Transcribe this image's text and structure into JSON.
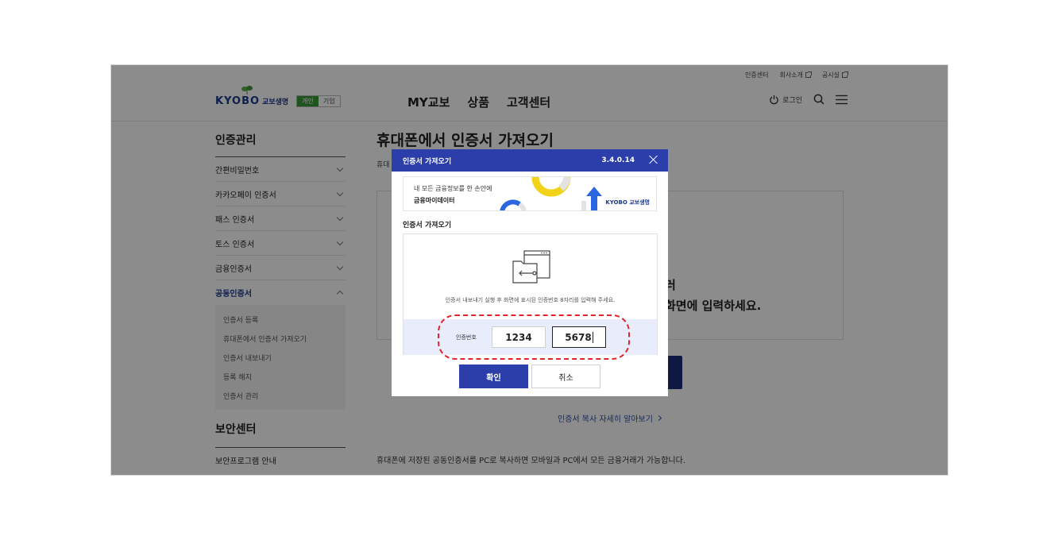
{
  "header": {
    "util": [
      "인증센터",
      "회사소개",
      "공시실"
    ],
    "logo_text": "KYOBO",
    "logo_kr": "교보생명",
    "toggle": [
      "개인",
      "기업"
    ],
    "gnb": [
      "MY교보",
      "상품",
      "고객센터"
    ],
    "login_label": "로그인"
  },
  "sidebar": {
    "title": "인증관리",
    "items": [
      {
        "label": "간편비밀번호"
      },
      {
        "label": "카카오페이 인증서"
      },
      {
        "label": "패스 인증서"
      },
      {
        "label": "토스 인증서"
      },
      {
        "label": "금융인증서"
      },
      {
        "label": "공동인증서"
      }
    ],
    "sub_items": [
      "인증서 등록",
      "휴대폰에서 인증서 가져오기",
      "인증서 내보내기",
      "등록 해지",
      "인증서 관리"
    ],
    "title2": "보안센터",
    "item2": "보안프로그램 안내"
  },
  "main": {
    "title": "휴대폰에서 인증서 가져오기",
    "desc_fragment": "휴대",
    "text_line1": "러",
    "text_line2": "화면에 입력하세요.",
    "more_link": "인증서 복사 자세히 알아보기",
    "footer": "휴대폰에 저장된 공동인증서를 PC로 복사하면 모바일과 PC에서 모든 금융거래가 가능합니다."
  },
  "modal": {
    "title": "인증서 가져오기",
    "version": "3.4.0.14",
    "banner_line1": "내 모든 금융정보를 한 손안에",
    "banner_line2": "금융마이데이터",
    "banner_logo": "KYOBO 교보생명",
    "subtitle": "인증서 가져오기",
    "instruction": "인증서 내보내기 실행 후 화면에 표시된 인증번호 8자리를 입력해 주세요.",
    "code_label": "인증번호",
    "code1": "1234",
    "code2": "5678",
    "ok_label": "확인",
    "cancel_label": "취소"
  },
  "colors": {
    "brand_blue": "#2b3ea9",
    "highlight_red": "#e0262c",
    "green": "#3a9a3a"
  }
}
